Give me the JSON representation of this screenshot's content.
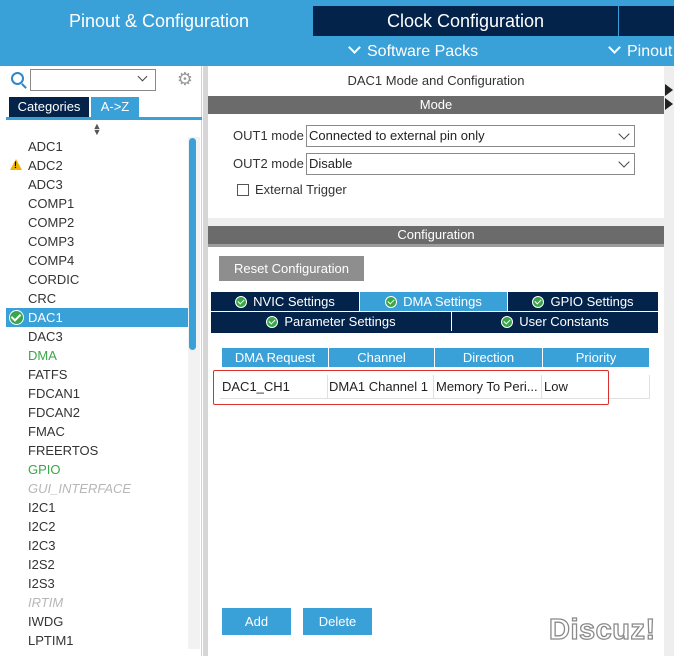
{
  "top_tabs": {
    "pinout": "Pinout & Configuration",
    "clock": "Clock Configuration"
  },
  "subnav": {
    "software_packs": "Software Packs",
    "pinout": "Pinout"
  },
  "left_panel": {
    "search": {
      "value": "",
      "placeholder": ""
    },
    "tabs": {
      "categories": "Categories",
      "atoz": "A->Z"
    },
    "items": [
      {
        "label": "ADC1",
        "state": "normal"
      },
      {
        "label": "ADC2",
        "state": "warning"
      },
      {
        "label": "ADC3",
        "state": "normal"
      },
      {
        "label": "COMP1",
        "state": "normal"
      },
      {
        "label": "COMP2",
        "state": "normal"
      },
      {
        "label": "COMP3",
        "state": "normal"
      },
      {
        "label": "COMP4",
        "state": "normal"
      },
      {
        "label": "CORDIC",
        "state": "normal"
      },
      {
        "label": "CRC",
        "state": "normal"
      },
      {
        "label": "DAC1",
        "state": "selected"
      },
      {
        "label": "DAC3",
        "state": "normal"
      },
      {
        "label": "DMA",
        "state": "green"
      },
      {
        "label": "FATFS",
        "state": "normal"
      },
      {
        "label": "FDCAN1",
        "state": "normal"
      },
      {
        "label": "FDCAN2",
        "state": "normal"
      },
      {
        "label": "FMAC",
        "state": "normal"
      },
      {
        "label": "FREERTOS",
        "state": "normal"
      },
      {
        "label": "GPIO",
        "state": "green"
      },
      {
        "label": "GUI_INTERFACE",
        "state": "grey"
      },
      {
        "label": "I2C1",
        "state": "normal"
      },
      {
        "label": "I2C2",
        "state": "normal"
      },
      {
        "label": "I2C3",
        "state": "normal"
      },
      {
        "label": "I2S2",
        "state": "normal"
      },
      {
        "label": "I2S3",
        "state": "normal"
      },
      {
        "label": "IRTIM",
        "state": "grey"
      },
      {
        "label": "IWDG",
        "state": "normal"
      },
      {
        "label": "LPTIM1",
        "state": "normal"
      }
    ]
  },
  "right_panel": {
    "title": "DAC1 Mode and Configuration",
    "mode_header": "Mode",
    "out1_label": "OUT1 mode",
    "out1_value": "Connected to external pin only",
    "out2_label": "OUT2 mode",
    "out2_value": "Disable",
    "external_trigger_label": "External Trigger",
    "external_trigger_checked": false,
    "config_header": "Configuration",
    "reset_button": "Reset Configuration",
    "tabs": {
      "nvic": "NVIC Settings",
      "dma": "DMA Settings",
      "gpio": "GPIO Settings",
      "param": "Parameter Settings",
      "user": "User Constants"
    },
    "dma_table": {
      "headers": [
        "DMA Request",
        "Channel",
        "Direction",
        "Priority"
      ],
      "rows": [
        [
          "DAC1_CH1",
          "DMA1 Channel 1",
          "Memory To Peri...",
          "Low"
        ]
      ]
    },
    "add_button": "Add",
    "delete_button": "Delete"
  },
  "watermark": "Discuz!",
  "colors": {
    "accent_blue": "#3aa0d8",
    "navy": "#03234b",
    "section_grey": "#6b6b6b",
    "active_green": "#3aa64a",
    "highlight_red": "#d9302f"
  }
}
